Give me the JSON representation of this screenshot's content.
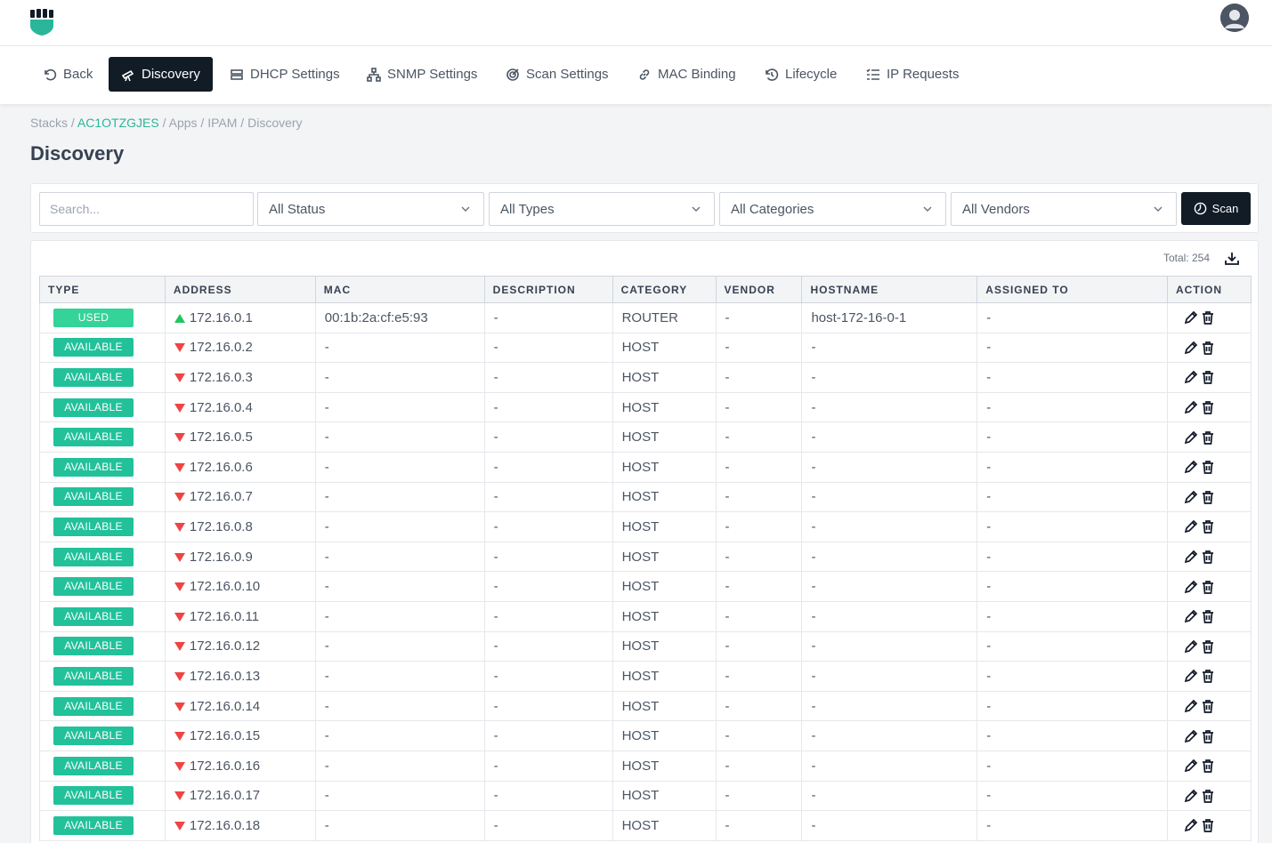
{
  "header": {
    "logo": "shield-logo",
    "avatar": "user-avatar"
  },
  "nav": [
    {
      "label": "Back",
      "icon": "undo-icon",
      "active": false
    },
    {
      "label": "Discovery",
      "icon": "telescope-icon",
      "active": true
    },
    {
      "label": "DHCP Settings",
      "icon": "server-icon",
      "active": false
    },
    {
      "label": "SNMP Settings",
      "icon": "network-icon",
      "active": false
    },
    {
      "label": "Scan Settings",
      "icon": "radar-icon",
      "active": false
    },
    {
      "label": "MAC Binding",
      "icon": "link-icon",
      "active": false
    },
    {
      "label": "Lifecycle",
      "icon": "history-icon",
      "active": false
    },
    {
      "label": "IP Requests",
      "icon": "list-check-icon",
      "active": false
    }
  ],
  "breadcrumb": {
    "stacks": "Stacks",
    "stack_id": "AC1OTZGJES",
    "apps": "Apps",
    "ipam": "IPAM",
    "current": "Discovery",
    "sep": " / "
  },
  "page": {
    "title": "Discovery"
  },
  "filters": {
    "search_placeholder": "Search...",
    "status": "All Status",
    "types": "All Types",
    "categories": "All Categories",
    "vendors": "All Vendors",
    "scan_label": "Scan"
  },
  "table": {
    "total": "Total: 254",
    "headers": {
      "type": "TYPE",
      "address": "ADDRESS",
      "mac": "MAC",
      "description": "DESCRIPTION",
      "category": "CATEGORY",
      "vendor": "VENDOR",
      "hostname": "HOSTNAME",
      "assigned": "ASSIGNED TO",
      "action": "ACTION"
    },
    "rows": [
      {
        "type": "USED",
        "status": "up",
        "address": "172.16.0.1",
        "mac": "00:1b:2a:cf:e5:93",
        "description": "-",
        "category": "ROUTER",
        "vendor": "-",
        "hostname": "host-172-16-0-1",
        "assigned": "-"
      },
      {
        "type": "AVAILABLE",
        "status": "down",
        "address": "172.16.0.2",
        "mac": "-",
        "description": "-",
        "category": "HOST",
        "vendor": "-",
        "hostname": "-",
        "assigned": "-"
      },
      {
        "type": "AVAILABLE",
        "status": "down",
        "address": "172.16.0.3",
        "mac": "-",
        "description": "-",
        "category": "HOST",
        "vendor": "-",
        "hostname": "-",
        "assigned": "-"
      },
      {
        "type": "AVAILABLE",
        "status": "down",
        "address": "172.16.0.4",
        "mac": "-",
        "description": "-",
        "category": "HOST",
        "vendor": "-",
        "hostname": "-",
        "assigned": "-"
      },
      {
        "type": "AVAILABLE",
        "status": "down",
        "address": "172.16.0.5",
        "mac": "-",
        "description": "-",
        "category": "HOST",
        "vendor": "-",
        "hostname": "-",
        "assigned": "-"
      },
      {
        "type": "AVAILABLE",
        "status": "down",
        "address": "172.16.0.6",
        "mac": "-",
        "description": "-",
        "category": "HOST",
        "vendor": "-",
        "hostname": "-",
        "assigned": "-"
      },
      {
        "type": "AVAILABLE",
        "status": "down",
        "address": "172.16.0.7",
        "mac": "-",
        "description": "-",
        "category": "HOST",
        "vendor": "-",
        "hostname": "-",
        "assigned": "-"
      },
      {
        "type": "AVAILABLE",
        "status": "down",
        "address": "172.16.0.8",
        "mac": "-",
        "description": "-",
        "category": "HOST",
        "vendor": "-",
        "hostname": "-",
        "assigned": "-"
      },
      {
        "type": "AVAILABLE",
        "status": "down",
        "address": "172.16.0.9",
        "mac": "-",
        "description": "-",
        "category": "HOST",
        "vendor": "-",
        "hostname": "-",
        "assigned": "-"
      },
      {
        "type": "AVAILABLE",
        "status": "down",
        "address": "172.16.0.10",
        "mac": "-",
        "description": "-",
        "category": "HOST",
        "vendor": "-",
        "hostname": "-",
        "assigned": "-"
      },
      {
        "type": "AVAILABLE",
        "status": "down",
        "address": "172.16.0.11",
        "mac": "-",
        "description": "-",
        "category": "HOST",
        "vendor": "-",
        "hostname": "-",
        "assigned": "-"
      },
      {
        "type": "AVAILABLE",
        "status": "down",
        "address": "172.16.0.12",
        "mac": "-",
        "description": "-",
        "category": "HOST",
        "vendor": "-",
        "hostname": "-",
        "assigned": "-"
      },
      {
        "type": "AVAILABLE",
        "status": "down",
        "address": "172.16.0.13",
        "mac": "-",
        "description": "-",
        "category": "HOST",
        "vendor": "-",
        "hostname": "-",
        "assigned": "-"
      },
      {
        "type": "AVAILABLE",
        "status": "down",
        "address": "172.16.0.14",
        "mac": "-",
        "description": "-",
        "category": "HOST",
        "vendor": "-",
        "hostname": "-",
        "assigned": "-"
      },
      {
        "type": "AVAILABLE",
        "status": "down",
        "address": "172.16.0.15",
        "mac": "-",
        "description": "-",
        "category": "HOST",
        "vendor": "-",
        "hostname": "-",
        "assigned": "-"
      },
      {
        "type": "AVAILABLE",
        "status": "down",
        "address": "172.16.0.16",
        "mac": "-",
        "description": "-",
        "category": "HOST",
        "vendor": "-",
        "hostname": "-",
        "assigned": "-"
      },
      {
        "type": "AVAILABLE",
        "status": "down",
        "address": "172.16.0.17",
        "mac": "-",
        "description": "-",
        "category": "HOST",
        "vendor": "-",
        "hostname": "-",
        "assigned": "-"
      },
      {
        "type": "AVAILABLE",
        "status": "down",
        "address": "172.16.0.18",
        "mac": "-",
        "description": "-",
        "category": "HOST",
        "vendor": "-",
        "hostname": "-",
        "assigned": "-"
      }
    ]
  },
  "colors": {
    "accent": "#2bb59a",
    "dark": "#111c27",
    "used": "#34d399",
    "available": "#22c19a",
    "up": "#22c55e",
    "down": "#ef4444"
  }
}
